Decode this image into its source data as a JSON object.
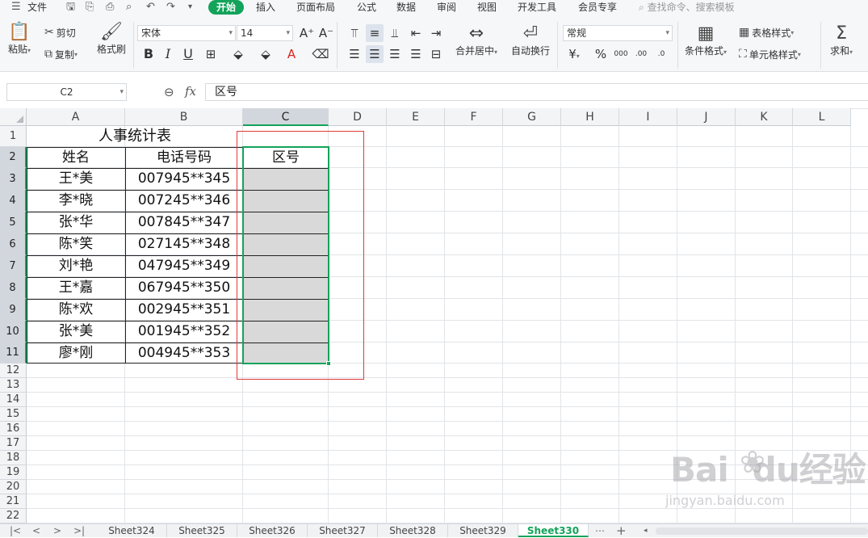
{
  "menu": {
    "file": "文件",
    "tabs": [
      "开始",
      "插入",
      "页面布局",
      "公式",
      "数据",
      "审阅",
      "视图",
      "开发工具",
      "会员专享"
    ],
    "active_tab": "开始",
    "search_placeholder": "查找命令、搜索模板"
  },
  "ribbon": {
    "paste": "粘贴",
    "cut": "剪切",
    "copy": "复制",
    "format_painter": "格式刷",
    "font_name": "宋体",
    "font_size": "14",
    "bold": "B",
    "italic": "I",
    "underline": "U",
    "merge_center": "合并居中",
    "wrap_text": "自动换行",
    "number_format": "常规",
    "currency": "¥",
    "percent": "%",
    "thousands": "000",
    "inc_decimal": ".00",
    "dec_decimal": ".0",
    "conditional_format": "条件格式",
    "table_style": "表格样式",
    "cell_style": "单元格样式",
    "sum": "求和"
  },
  "formula_bar": {
    "name_box": "C2",
    "fx": "fx",
    "content": "区号"
  },
  "sheet": {
    "columns": [
      "A",
      "B",
      "C",
      "D",
      "E",
      "F",
      "G",
      "H",
      "I",
      "J",
      "K",
      "L"
    ],
    "rows": [
      "1",
      "2",
      "3",
      "4",
      "5",
      "6",
      "7",
      "8",
      "9",
      "10",
      "11",
      "12",
      "13",
      "14",
      "15",
      "16",
      "17",
      "18",
      "19",
      "20",
      "21",
      "22"
    ],
    "selected_column": "C",
    "title": "人事统计表",
    "headers": [
      "姓名",
      "电话号码",
      "区号"
    ],
    "records": [
      {
        "name": "王*美",
        "phone": "007945**345"
      },
      {
        "name": "李*晓",
        "phone": "007245**346"
      },
      {
        "name": "张*华",
        "phone": "007845**347"
      },
      {
        "name": "陈*笑",
        "phone": "027145**348"
      },
      {
        "name": "刘*艳",
        "phone": "047945**349"
      },
      {
        "name": "王*嘉",
        "phone": "067945**350"
      },
      {
        "name": "陈*欢",
        "phone": "002945**351"
      },
      {
        "name": "张*美",
        "phone": "001945**352"
      },
      {
        "name": "廖*刚",
        "phone": "004945**353"
      }
    ]
  },
  "sheet_tabs": [
    "Sheet324",
    "Sheet325",
    "Sheet326",
    "Sheet327",
    "Sheet328",
    "Sheet329",
    "Sheet330"
  ],
  "active_sheet": "Sheet330",
  "watermark": {
    "brand": "Bai",
    "brand2": "du",
    "brand3": "经验",
    "url": "jingyan.baidu.com"
  }
}
